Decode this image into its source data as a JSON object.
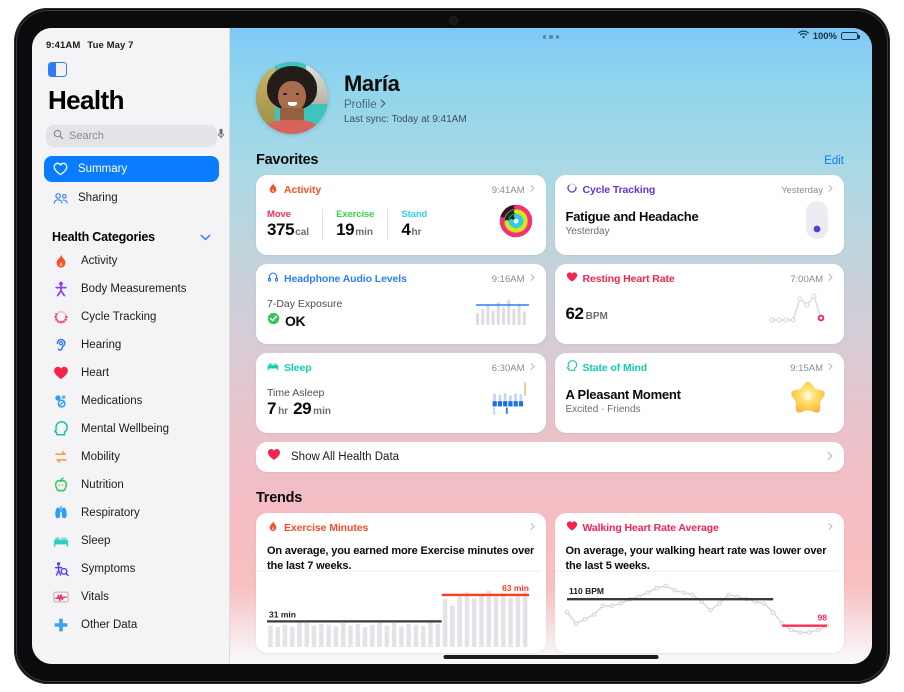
{
  "status_bar": {
    "time": "9:41AM",
    "date": "Tue May 7",
    "wifi_icon": "wifi-icon",
    "battery_percent": "100%",
    "battery_icon": "battery-full-icon"
  },
  "sidebar": {
    "toggle_icon": "sidebar-toggle-icon",
    "title": "Health",
    "search": {
      "placeholder": "Search",
      "value": "",
      "icon": "search-icon",
      "mic_icon": "microphone-icon"
    },
    "nav": [
      {
        "label": "Summary",
        "icon": "heart-outline-icon",
        "selected": true
      },
      {
        "label": "Sharing",
        "icon": "people-icon",
        "selected": false
      }
    ],
    "categories_header": {
      "label": "Health Categories",
      "chevron": "chevron-down-icon"
    },
    "categories": [
      {
        "label": "Activity",
        "icon": "flame-icon",
        "color": "#f5502a"
      },
      {
        "label": "Body Measurements",
        "icon": "body-figure-icon",
        "color": "#8b3df5"
      },
      {
        "label": "Cycle Tracking",
        "icon": "cycle-dots-icon",
        "color": "#f2406e"
      },
      {
        "label": "Hearing",
        "icon": "ear-icon",
        "color": "#2f7df6"
      },
      {
        "label": "Heart",
        "icon": "heart-filled-icon",
        "color": "#f5244e"
      },
      {
        "label": "Medications",
        "icon": "pills-icon",
        "color": "#2f9ef6"
      },
      {
        "label": "Mental Wellbeing",
        "icon": "head-profile-icon",
        "color": "#1fbfae"
      },
      {
        "label": "Mobility",
        "icon": "arrows-icon",
        "color": "#f2a33c"
      },
      {
        "label": "Nutrition",
        "icon": "apple-icon",
        "color": "#34c759"
      },
      {
        "label": "Respiratory",
        "icon": "lungs-icon",
        "color": "#2f9ef6"
      },
      {
        "label": "Sleep",
        "icon": "bed-icon",
        "color": "#2ecfc0"
      },
      {
        "label": "Symptoms",
        "icon": "person-magnify-icon",
        "color": "#5a3df5"
      },
      {
        "label": "Vitals",
        "icon": "waveform-box-icon",
        "color": "#f5244e"
      },
      {
        "label": "Other Data",
        "icon": "plus-cross-icon",
        "color": "#3aa3f5"
      }
    ]
  },
  "profile": {
    "avatar": "user-avatar",
    "name": "María",
    "link_label": "Profile",
    "link_chevron": "chevron-right-icon",
    "last_sync": "Last sync: Today at 9:41AM"
  },
  "favorites": {
    "title": "Favorites",
    "edit_label": "Edit",
    "cards": [
      {
        "id": "activity",
        "title": "Activity",
        "title_color": "#f5502a",
        "icon": "flame-icon",
        "time": "9:41AM",
        "metrics": [
          {
            "name": "Move",
            "color": "#fa2f55",
            "value": "375",
            "unit": "cal"
          },
          {
            "name": "Exercise",
            "color": "#3ad449",
            "value": "19",
            "unit": "min"
          },
          {
            "name": "Stand",
            "color": "#2ed2ea",
            "value": "4",
            "unit": "hr"
          }
        ],
        "viz": "activity-rings"
      },
      {
        "id": "cycle-tracking",
        "title": "Cycle Tracking",
        "title_color": "#6236d8",
        "icon": "cycle-dots-icon",
        "time": "Yesterday",
        "headline": "Fatigue and Headache",
        "subline": "Yesterday",
        "viz": "cycle-pill"
      },
      {
        "id": "headphone-audio-levels",
        "title": "Headphone Audio Levels",
        "title_color": "#2f7df6",
        "icon": "headphone-icon",
        "time": "9:16AM",
        "sub_label": "7-Day Exposure",
        "status_value": "OK",
        "status_icon": "check-circle-icon",
        "status_color": "#34c759",
        "viz": "audio-bars"
      },
      {
        "id": "resting-heart-rate",
        "title": "Resting Heart Rate",
        "title_color": "#f5244e",
        "icon": "heart-filled-icon",
        "time": "7:00AM",
        "value": "62",
        "unit": "BPM",
        "viz": "heart-line"
      },
      {
        "id": "sleep",
        "title": "Sleep",
        "title_color": "#15cbb4",
        "icon": "bed-icon",
        "time": "6:30AM",
        "sub_label": "Time Asleep",
        "value_hours": "7",
        "unit_hours": "hr",
        "value_minutes": "29",
        "unit_minutes": "min",
        "viz": "sleep-bars"
      },
      {
        "id": "state-of-mind",
        "title": "State of Mind",
        "title_color": "#15cbb4",
        "icon": "head-profile-icon",
        "time": "9:15AM",
        "headline": "A Pleasant Moment",
        "subline": "Excited · Friends",
        "viz": "mood-star"
      }
    ]
  },
  "show_all": {
    "label": "Show All Health Data",
    "icon": "heart-filled-icon",
    "chevron": "chevron-right-icon"
  },
  "trends": {
    "title": "Trends",
    "cards": [
      {
        "id": "exercise-minutes",
        "title": "Exercise Minutes",
        "title_color": "#f5502a",
        "icon": "flame-icon",
        "description": "On average, you earned more Exercise minutes over the last 7 weeks.",
        "baseline_label": "31 min",
        "current_label": "63 min"
      },
      {
        "id": "walking-heart-rate-average",
        "title": "Walking Heart Rate Average",
        "title_color": "#f5244e",
        "icon": "heart-filled-icon",
        "description": "On average, your walking heart rate was lower over the last 5 weeks.",
        "baseline_label": "110 BPM",
        "current_label": "98"
      }
    ]
  },
  "chart_data": [
    {
      "type": "bar",
      "id": "exercise-minutes-trend",
      "title": "Exercise Minutes",
      "ylabel": "minutes",
      "baseline": 31,
      "baseline_label": "31 min",
      "current": 63,
      "current_label": "63 min",
      "baseline_color": "#3a3a3c",
      "current_color": "#ff3b20",
      "bar_color": "#e3e3e8",
      "grid": false,
      "values": [
        26,
        24,
        27,
        25,
        30,
        29,
        26,
        28,
        27,
        25,
        29,
        26,
        28,
        24,
        27,
        30,
        26,
        29,
        25,
        28,
        27,
        26,
        30,
        28,
        58,
        50,
        62,
        66,
        59,
        64,
        68,
        61,
        65,
        60,
        63,
        66
      ],
      "baseline_span": [
        0,
        23
      ],
      "current_span": [
        24,
        35
      ]
    },
    {
      "type": "line",
      "id": "walking-heart-rate-trend",
      "title": "Walking Heart Rate Average",
      "ylabel": "BPM",
      "baseline": 110,
      "baseline_label": "110 BPM",
      "current": 98,
      "current_label": "98",
      "baseline_color": "#3a3a3c",
      "current_color": "#ff2d55",
      "line_color": "#d6d6da",
      "grid": false,
      "x": [
        0,
        1,
        2,
        3,
        4,
        5,
        6,
        7,
        8,
        9,
        10,
        11,
        12,
        13,
        14,
        15,
        16,
        17,
        18,
        19,
        20,
        21,
        22,
        23,
        24,
        25,
        26,
        27,
        28,
        29
      ],
      "values": [
        104,
        99,
        101,
        103,
        107,
        107,
        108,
        110,
        111,
        113,
        115,
        116,
        114,
        113,
        112,
        109,
        105,
        108,
        112,
        111,
        110,
        109,
        108,
        104,
        99,
        96,
        95,
        95,
        96,
        98
      ]
    }
  ]
}
